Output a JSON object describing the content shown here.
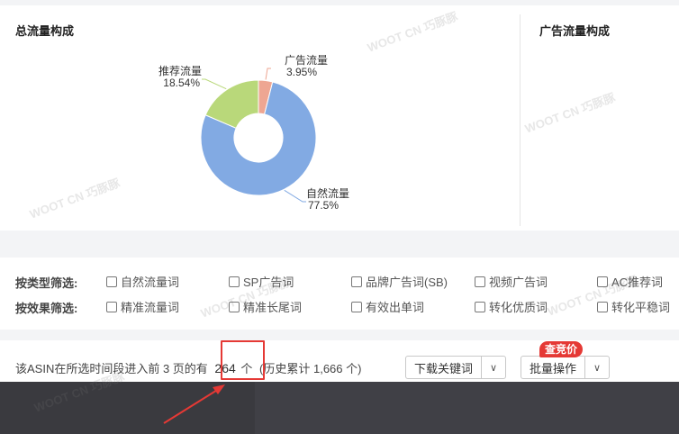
{
  "charts": {
    "total_title": "总流量构成",
    "ad_title": "广告流量构成"
  },
  "chart_data": {
    "type": "pie",
    "title": "总流量构成",
    "donut": true,
    "slices": [
      {
        "name": "自然流量",
        "value": 77.5,
        "label_value": "77.5%",
        "color": "#82aae3"
      },
      {
        "name": "推荐流量",
        "value": 18.54,
        "label_value": "18.54%",
        "color": "#b9d87a"
      },
      {
        "name": "广告流量",
        "value": 3.95,
        "label_value": "3.95%",
        "color": "#eea692"
      }
    ]
  },
  "filters": {
    "type_label": "按类型筛选:",
    "effect_label": "按效果筛选:",
    "type_options": [
      "自然流量词",
      "SP广告词",
      "品牌广告词(SB)",
      "视频广告词",
      "AC推荐词"
    ],
    "effect_options": [
      "精准流量词",
      "精准长尾词",
      "有效出单词",
      "转化优质词",
      "转化平稳词"
    ]
  },
  "summary": {
    "prefix": "该ASIN在所选时间段进入前 3 页的有",
    "count": "264",
    "unit": "个",
    "history": "(历史累计 1,666 个)"
  },
  "buttons": {
    "download_label": "下载关键词",
    "batch_label": "批量操作",
    "badge_label": "查竞价"
  },
  "watermark": "WOOT CN 巧豚豚",
  "colors": {
    "accent_red": "#e53935",
    "natural": "#82aae3",
    "recommend": "#b9d87a",
    "ads": "#eea692"
  }
}
